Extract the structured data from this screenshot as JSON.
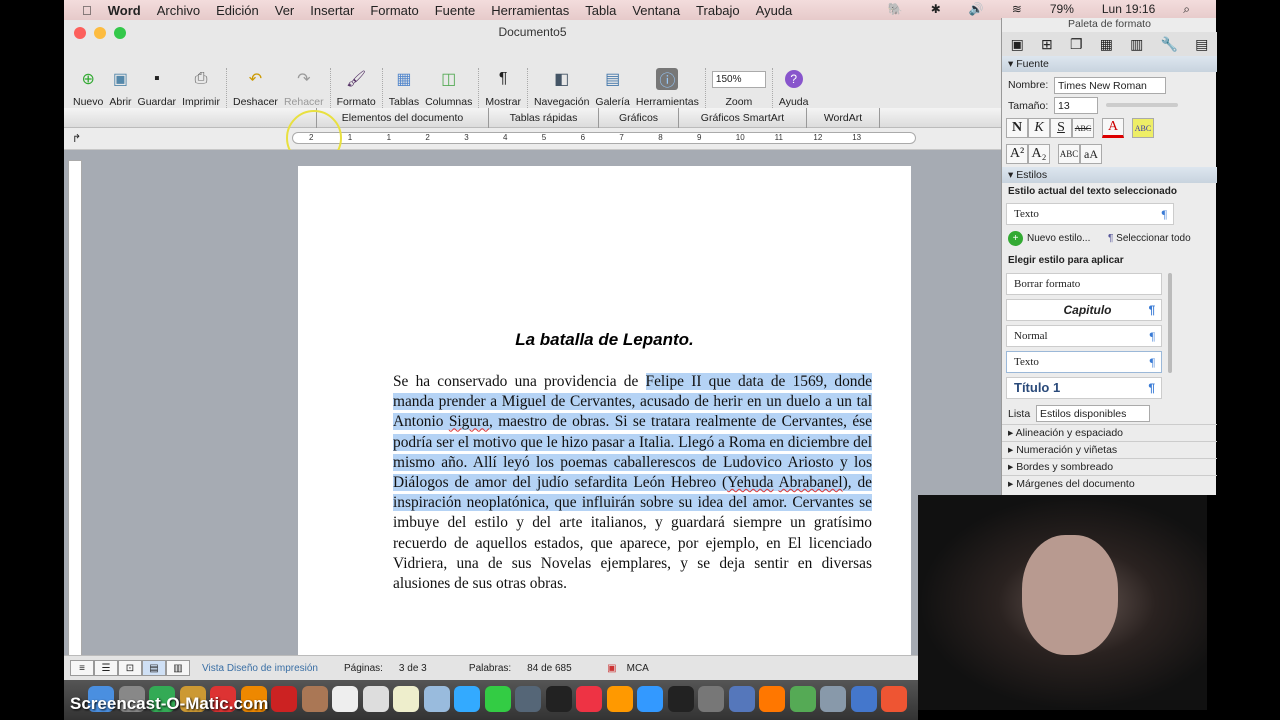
{
  "menubar": {
    "apple": "",
    "app": "Word",
    "items": [
      "Archivo",
      "Edición",
      "Ver",
      "Insertar",
      "Formato",
      "Fuente",
      "Herramientas",
      "Tabla",
      "Ventana",
      "Trabajo",
      "Ayuda"
    ],
    "battery": "79%",
    "clock": "Lun 19:16"
  },
  "window": {
    "title": "Documento5"
  },
  "toolbar": [
    {
      "label": "Nuevo",
      "icon": "new-doc-icon"
    },
    {
      "label": "Abrir",
      "icon": "open-icon"
    },
    {
      "label": "Guardar",
      "icon": "save-icon"
    },
    {
      "label": "Imprimir",
      "icon": "print-icon"
    },
    {
      "label": "Deshacer",
      "icon": "undo-icon"
    },
    {
      "label": "Rehacer",
      "icon": "redo-icon"
    },
    {
      "label": "Formato",
      "icon": "format-brush-icon"
    },
    {
      "label": "Tablas",
      "icon": "table-icon"
    },
    {
      "label": "Columnas",
      "icon": "columns-icon"
    },
    {
      "label": "Mostrar",
      "icon": "pilcrow-icon"
    },
    {
      "label": "Navegación",
      "icon": "navigation-icon"
    },
    {
      "label": "Galería",
      "icon": "gallery-icon"
    },
    {
      "label": "Herramientas",
      "icon": "toolbox-icon"
    }
  ],
  "zoom": {
    "value": "150%",
    "label": "Zoom"
  },
  "help": {
    "label": "Ayuda"
  },
  "ribbon_tabs": [
    "Elementos del documento",
    "Tablas rápidas",
    "Gráficos",
    "Gráficos SmartArt",
    "WordArt"
  ],
  "ruler_ticks": [
    "2",
    "1",
    "1",
    "2",
    "3",
    "4",
    "5",
    "6",
    "7",
    "8",
    "9",
    "10",
    "11",
    "12",
    "13"
  ],
  "document": {
    "title": "La batalla de Lepanto.",
    "para_before": "Se ha conservado una providencia de ",
    "para_sel_1": "Felipe II que data de 1569, donde manda prender a Miguel de Cervantes, acusado de herir en un duelo a un tal Antonio ",
    "para_sel_sp1": "Sigura",
    "para_sel_2": ", maestro de obras. Si se tratara realmente de Cervantes, ése podría ser el motivo que le hizo pasar a Italia. Llegó a Roma en diciembre del mismo año. Allí leyó los poemas caballerescos de Ludovico Ariosto y los Diálogos de amor del judío sefardita León Hebreo (",
    "para_sel_sp2": "Yehuda",
    "para_sel_3": " ",
    "para_sel_sp3": "Abrabanel",
    "para_sel_4": "), de inspiración neoplatónica, que influirán sobre su idea del amor. Cervantes se ",
    "para_after": "imbuye del estilo y del arte italianos, y guardará siempre un gratísimo recuerdo de aquellos estados, que aparece, por ejemplo, en El licenciado Vidriera, una de sus Novelas ejemplares, y se deja sentir en diversas alusiones de sus otras obras."
  },
  "statusbar": {
    "view": "Vista Diseño de impresión",
    "pages_label": "Páginas:",
    "pages_value": "3 de 3",
    "words_label": "Palabras:",
    "words_value": "84 de 685",
    "mode": "MCA"
  },
  "watermark": "Screencast-O-Matic.com",
  "palette": {
    "title": "Paleta de formato",
    "font_section": "Fuente",
    "name_label": "Nombre:",
    "name_value": "Times New Roman",
    "size_label": "Tamaño:",
    "size_value": "13",
    "format_buttons": [
      "N",
      "K",
      "S",
      "ABC"
    ],
    "script_buttons": [
      "A²",
      "A₂"
    ],
    "case_buttons": [
      "ABC",
      "aA"
    ],
    "styles_section": "Estilos",
    "current_style_heading": "Estilo actual del texto seleccionado",
    "current_style": "Texto",
    "new_style": "Nuevo estilo...",
    "select_all": "Seleccionar todo",
    "apply_heading": "Elegir estilo para aplicar",
    "styles": [
      "Borrar formato",
      "Capitulo",
      "Normal",
      "Texto",
      "Título 1"
    ],
    "list_label": "Lista",
    "list_value": "Estilos disponibles",
    "collapsed": [
      "Alineación y espaciado",
      "Numeración y viñetas",
      "Bordes y sombreado",
      "Márgenes del documento"
    ]
  },
  "colors": {
    "selection": "#b5d3f5",
    "menubar": "#f3dcdc",
    "doc_background": "#a6abb3",
    "accent": "#3a7bd5"
  }
}
